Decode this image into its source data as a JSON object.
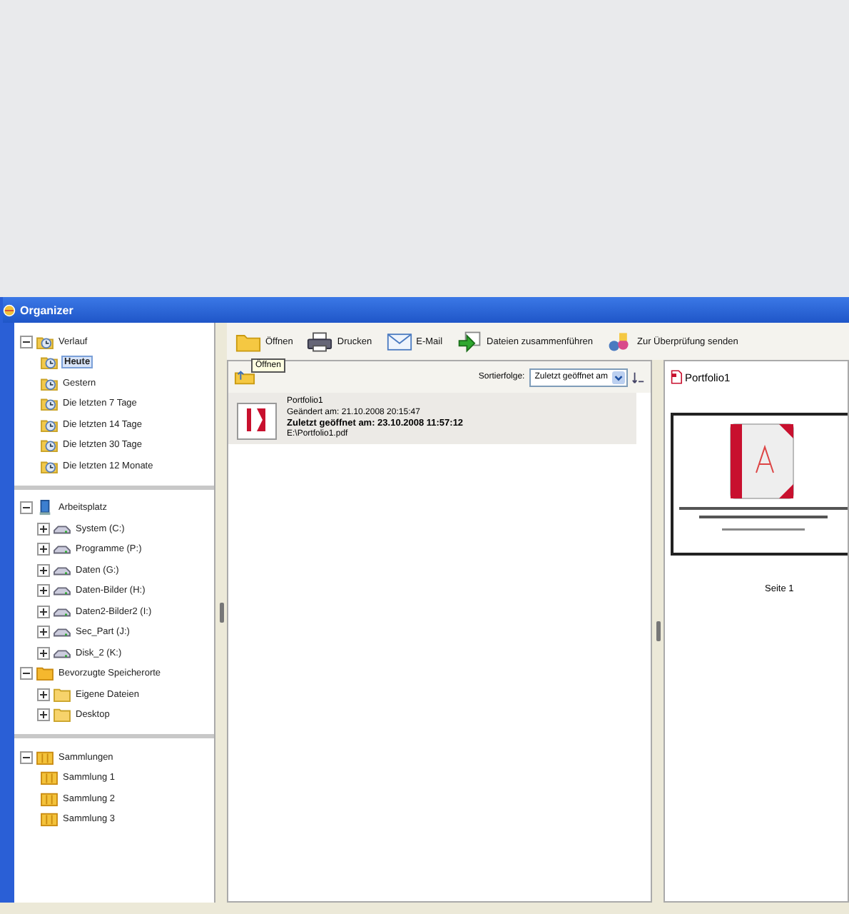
{
  "window": {
    "title": "Organizer"
  },
  "sidebar": {
    "sections": [
      {
        "items": [
          {
            "label": "Verlauf",
            "kind": "history",
            "expanded": true,
            "selected": false,
            "children": [
              {
                "label": "Heute",
                "kind": "history",
                "selected": true
              },
              {
                "label": "Gestern",
                "kind": "history",
                "selected": false
              },
              {
                "label": "Die letzten 7 Tage",
                "kind": "history",
                "selected": false
              },
              {
                "label": "Die letzten 14 Tage",
                "kind": "history",
                "selected": false
              },
              {
                "label": "Die letzten 30 Tage",
                "kind": "history",
                "selected": false
              },
              {
                "label": "Die letzten 12 Monate",
                "kind": "history",
                "selected": false
              }
            ]
          }
        ]
      },
      {
        "items": [
          {
            "label": "Arbeitsplatz",
            "kind": "computer",
            "expanded": true,
            "selected": false,
            "children": [
              {
                "label": "System (C:)",
                "kind": "drive",
                "expanded": false,
                "selected": false
              },
              {
                "label": "Programme (P:)",
                "kind": "drive",
                "expanded": false,
                "selected": false
              },
              {
                "label": "Daten (G:)",
                "kind": "drive",
                "expanded": false,
                "selected": false
              },
              {
                "label": "Daten-Bilder (H:)",
                "kind": "drive",
                "expanded": false,
                "selected": false
              },
              {
                "label": "Daten2-Bilder2 (I:)",
                "kind": "drive",
                "expanded": false,
                "selected": false
              },
              {
                "label": "Sec_Part (J:)",
                "kind": "drive",
                "expanded": false,
                "selected": false
              },
              {
                "label": "Disk_2 (K:)",
                "kind": "drive",
                "expanded": false,
                "selected": false
              }
            ]
          },
          {
            "label": "Bevorzugte Speicherorte",
            "kind": "favorites",
            "expanded": true,
            "selected": false,
            "children": [
              {
                "label": "Eigene Dateien",
                "kind": "folder",
                "expanded": false,
                "selected": false
              },
              {
                "label": "Desktop",
                "kind": "folder",
                "expanded": false,
                "selected": false
              }
            ]
          }
        ]
      },
      {
        "items": [
          {
            "label": "Sammlungen",
            "kind": "collection",
            "expanded": true,
            "selected": false,
            "children": [
              {
                "label": "Sammlung 1",
                "kind": "collection",
                "selected": false
              },
              {
                "label": "Sammlung 2",
                "kind": "collection",
                "selected": false
              },
              {
                "label": "Sammlung 3",
                "kind": "collection",
                "selected": false
              }
            ]
          }
        ]
      }
    ]
  },
  "toolbar": {
    "buttons": [
      {
        "label": "Öffnen",
        "kind": "open"
      },
      {
        "label": "Drucken",
        "kind": "print"
      },
      {
        "label": "E-Mail",
        "kind": "mail"
      },
      {
        "label": "Dateien zusammenführen",
        "kind": "merge"
      },
      {
        "label": "Zur Überprüfung senden",
        "kind": "review"
      }
    ]
  },
  "tooltip": "Öffnen",
  "list_header": {
    "sort_label": "Sortierfolge:",
    "sort_value": "Zuletzt geöffnet am"
  },
  "files": [
    {
      "name": "Portfolio1",
      "modified": "Geändert am: 21.10.2008 20:15:47",
      "opened": "Zuletzt geöffnet am: 23.10.2008 11:57:12",
      "path": "E:\\Portfolio1.pdf",
      "selected": true
    }
  ],
  "preview": {
    "title": "Portfolio1",
    "page_label": "Seite 1"
  }
}
